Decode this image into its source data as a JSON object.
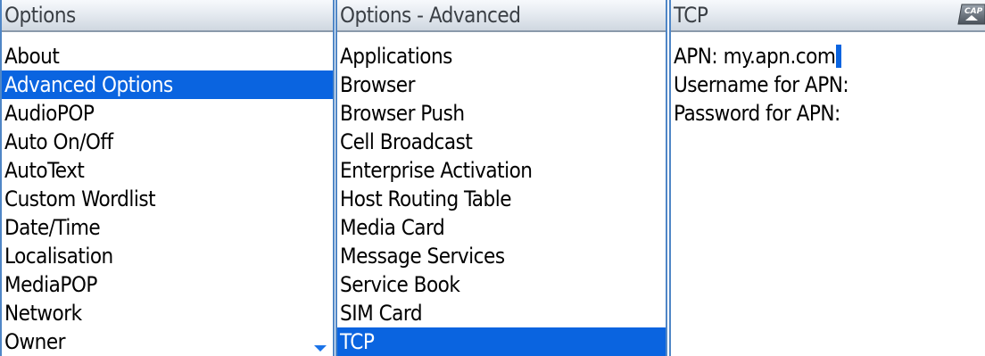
{
  "screens": [
    {
      "title": "Options",
      "items": [
        {
          "label": "About",
          "selected": false
        },
        {
          "label": "Advanced Options",
          "selected": true
        },
        {
          "label": "AudioPOP",
          "selected": false
        },
        {
          "label": "Auto On/Off",
          "selected": false
        },
        {
          "label": "AutoText",
          "selected": false
        },
        {
          "label": "Custom Wordlist",
          "selected": false
        },
        {
          "label": "Date/Time",
          "selected": false
        },
        {
          "label": "Localisation",
          "selected": false
        },
        {
          "label": "MediaPOP",
          "selected": false
        },
        {
          "label": "Network",
          "selected": false
        },
        {
          "label": "Owner",
          "selected": false
        }
      ],
      "scroll_indicator": "chevron-down-icon"
    },
    {
      "title": "Options - Advanced",
      "items": [
        {
          "label": "Applications",
          "selected": false
        },
        {
          "label": "Browser",
          "selected": false
        },
        {
          "label": "Browser Push",
          "selected": false
        },
        {
          "label": "Cell Broadcast",
          "selected": false
        },
        {
          "label": "Enterprise Activation",
          "selected": false
        },
        {
          "label": "Host Routing Table",
          "selected": false
        },
        {
          "label": "Media Card",
          "selected": false
        },
        {
          "label": "Message Services",
          "selected": false
        },
        {
          "label": "Service Book",
          "selected": false
        },
        {
          "label": "SIM Card",
          "selected": false
        },
        {
          "label": "TCP",
          "selected": true
        }
      ]
    },
    {
      "title": "TCP",
      "cap_indicator": "CAP",
      "fields": [
        {
          "label": "APN:",
          "value": "my.apn.com"
        },
        {
          "label": "Username for APN:",
          "value": ""
        },
        {
          "label": "Password for APN:",
          "value": ""
        }
      ]
    }
  ],
  "colors": {
    "selection": "#0a64e0",
    "frame": "#4f86c6",
    "title_text": "#3a3f45",
    "scroll_arrow": "#1a73e8"
  }
}
